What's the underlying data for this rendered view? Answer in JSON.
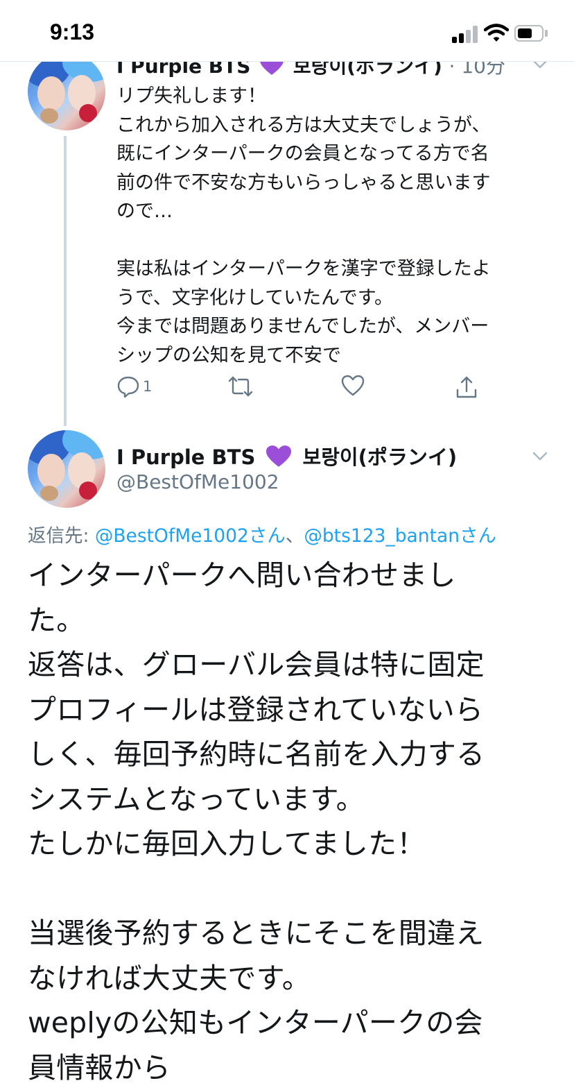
{
  "status_bar": {
    "time": "9:13"
  },
  "tweet1": {
    "name": "I Purple BTS",
    "display_suffix": "보랑이(ポランイ)",
    "time_ago": "· 10分",
    "body": "リプ失礼します！\nこれから加入される方は大丈夫でしょうが、\n既にインターパークの会員となってる方で名\n前の件で不安な方もいらっしゃると思います\nので…\n\n実は私はインターパークを漢字で登録したよ\nうで、文字化けしていたんです。\n今までは問題ありませんでしたが、メンバー\nシップの公知を見て不安で",
    "actions": {
      "reply_count": "1"
    }
  },
  "tweet2": {
    "name": "I Purple BTS",
    "display_suffix": "보랑이(ポランイ)",
    "handle": "@BestOfMe1002",
    "reply_to_label": "返信先:",
    "reply_to_mention1": "@BestOfMe1002さん",
    "reply_to_separator": "、",
    "reply_to_mention2": "@bts123_bantanさん",
    "body": "インターパークへ問い合わせまし\nた。\n返答は、グローバル会員は特に固定\nプロフィールは登録されていないら\nしく、毎回予約時に名前を入力する\nシステムとなっています。\nたしかに毎回入力してました！\n\n当選後予約するときにそこを間違え\nなければ大丈夫です。\nweplyの公知もインターパークの会\n員情報から"
  },
  "icons": {
    "heart_emoji": "purple-heart-icon",
    "reply": "reply-icon",
    "retweet": "retweet-icon",
    "like": "like-icon",
    "share": "share-icon",
    "more": "chevron-down-icon"
  },
  "colors": {
    "text": "#14171a",
    "secondary": "#657786",
    "link": "#1da1f2",
    "thread_line": "#ccd6dd",
    "purple_heart": "#9b4fd8"
  }
}
